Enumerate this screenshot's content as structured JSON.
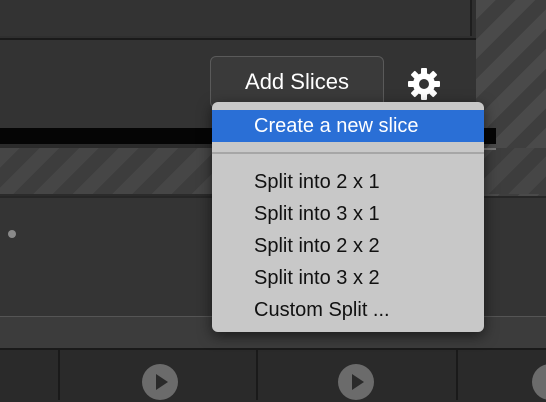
{
  "toolbar": {
    "add_slices_label": "Add Slices",
    "settings_icon": "gear-icon"
  },
  "menu": {
    "items": [
      {
        "label": "Create a new slice",
        "highlighted": true
      },
      {
        "label": "Split into 2 x 1"
      },
      {
        "label": "Split into 3 x 1"
      },
      {
        "label": "Split into 2 x 2"
      },
      {
        "label": "Split into 3 x 2"
      },
      {
        "label": "Custom Split ..."
      }
    ]
  },
  "colors": {
    "highlight": "#2a6fd6",
    "menu_bg": "#c8c8c8",
    "app_bg": "#2b2b2b"
  },
  "timeline": {
    "icons": [
      "play-icon",
      "play-icon",
      "play-icon"
    ]
  }
}
